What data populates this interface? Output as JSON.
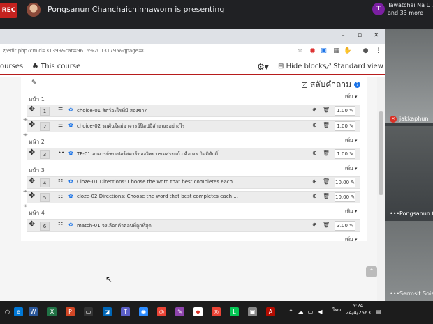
{
  "meeting": {
    "rec_label": "REC",
    "presenter_text": "Pongsanun Chanchaichinnaworn is presenting",
    "participant_initial": "T",
    "participant_name": "Tawatchai Na U ...",
    "participant_more": "and 33 more"
  },
  "browser": {
    "url": "z/edit.php?cmid=31399&cat=9616%2C131795&qpage=0",
    "nav": {
      "courses": "ourses",
      "this_course": "This course",
      "hide_blocks": "Hide blocks",
      "standard_view": "Standard view"
    }
  },
  "quiz": {
    "shuffle_label": "สลับคำถาม",
    "add_label": "เพิ่ม",
    "pages": [
      {
        "label": "หน้า 1",
        "questions": [
          {
            "num": "1",
            "text": "choice-01 สัตว์อะไรที่มี สองขา?",
            "mark": "1.00"
          },
          {
            "num": "2",
            "text": "choice-02 รถคันใหม่อาจารย์ป๊อปมีลักษณะอย่างไร",
            "mark": "1.00"
          }
        ]
      },
      {
        "label": "หน้า 2",
        "questions": [
          {
            "num": "3",
            "text": "TF-01 อาจารย์ชปเปอร์สตาร์ของวิทยาเขตสระแก้ว คือ ดร.กิตติศักดิ์",
            "mark": "1.00"
          }
        ]
      },
      {
        "label": "หน้า 3",
        "questions": [
          {
            "num": "4",
            "text": "Cloze-01 Directions: Choose the word that best completes each ...",
            "mark": "10.00"
          },
          {
            "num": "5",
            "text": "cloze-02 Directions: Choose the word that best completes each ...",
            "mark": "10.00"
          }
        ]
      },
      {
        "label": "หน้า 4",
        "questions": [
          {
            "num": "6",
            "text": "match-01 จงเลือกคำตอบที่ถูกที่สุด",
            "mark": "3.00"
          }
        ]
      }
    ]
  },
  "sidebar": {
    "tiles": [
      {
        "name": "jakkaphun",
        "muted": true
      },
      {
        "name": "Pongsanun C",
        "muted": false
      },
      {
        "name": "Sermsit Sois",
        "muted": false
      }
    ]
  },
  "taskbar": {
    "lang": "ไทย",
    "time": "15:24",
    "date": "24/4/2563"
  },
  "colors": {
    "accent_red": "#b71c1c",
    "rec_red": "#c5221f",
    "link_blue": "#1a73e8"
  }
}
